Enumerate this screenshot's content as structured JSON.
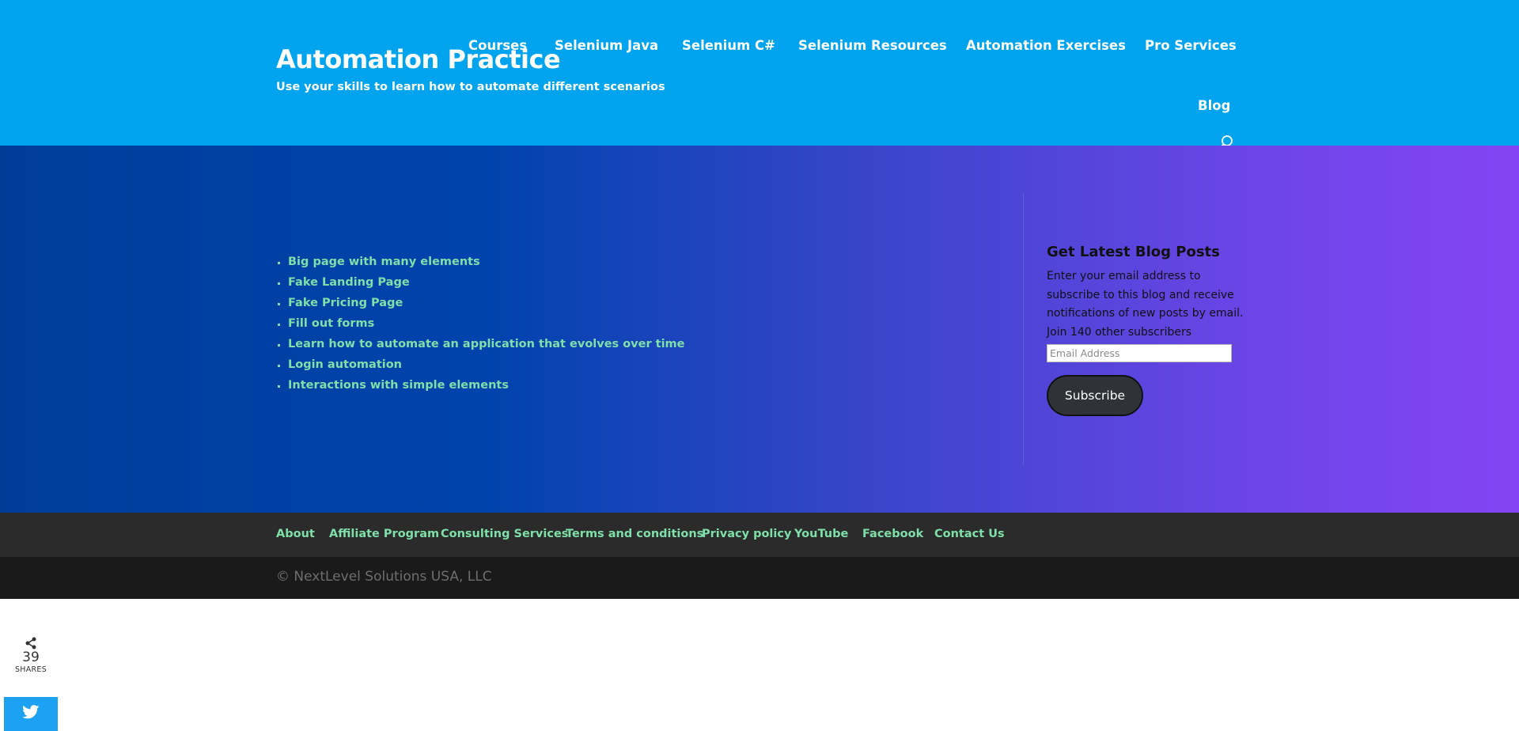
{
  "header": {
    "title": "Automation Practice",
    "tagline": "Use your skills to learn how to automate different scenarios",
    "nav": [
      "Courses",
      "Selenium Java",
      "Selenium C#",
      "Selenium Resources",
      "Automation Exercises",
      "Pro Services",
      "Blog"
    ],
    "search_icon": "search-icon"
  },
  "main": {
    "links": [
      "Big page with many elements",
      "Fake Landing Page",
      "Fake Pricing Page",
      "Fill out forms",
      "Learn how to automate an application that evolves over time",
      "Login automation",
      "Interactions with simple elements"
    ]
  },
  "sidebar": {
    "title": "Get Latest Blog Posts",
    "description": "Enter your email address to subscribe to this blog and receive notifications of new posts by email.",
    "subscribers": "Join 140 other subscribers",
    "email_placeholder": "Email Address",
    "subscribe_label": "Subscribe"
  },
  "footer": {
    "links": [
      "About",
      "Affiliate Program",
      "Consulting Services",
      "Terms and conditions",
      "Privacy policy",
      "YouTube",
      "Facebook",
      "Contact Us"
    ],
    "copyright": "© NextLevel Solutions USA, LLC"
  },
  "share": {
    "count": "39",
    "label": "SHARES",
    "twitter_icon": "twitter-icon"
  },
  "colors": {
    "header_bg": "#00a3ee",
    "link_green": "#7ee0a8",
    "footer_menu_bg": "#2b2b2b",
    "footer_bottom_bg": "#1a1a1a",
    "twitter_blue": "#1da1f2"
  }
}
